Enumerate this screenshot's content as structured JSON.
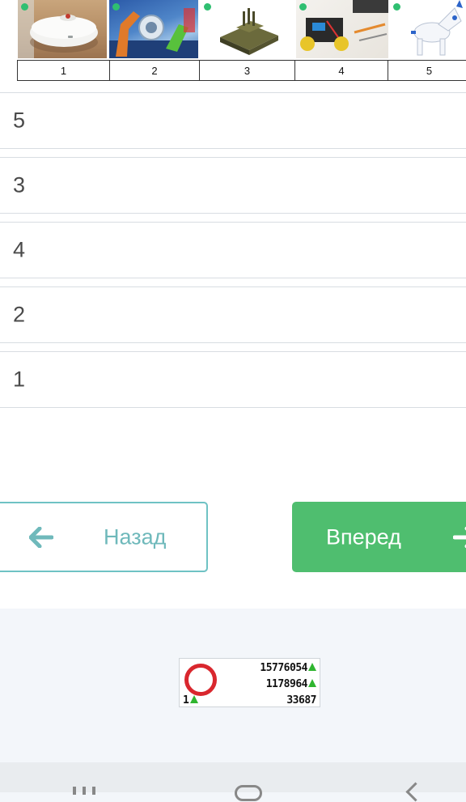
{
  "images": [
    {
      "number": "1",
      "icon": "robot-vacuum"
    },
    {
      "number": "2",
      "icon": "industrial-robot-arm"
    },
    {
      "number": "3",
      "icon": "robotic-tank"
    },
    {
      "number": "4",
      "icon": "diy-robot-kit"
    },
    {
      "number": "5",
      "icon": "robot-dog"
    }
  ],
  "answers": [
    "5",
    "3",
    "4",
    "2",
    "1"
  ],
  "buttons": {
    "back_label": "Назад",
    "next_label": "Вперед"
  },
  "counter": {
    "line1": "15776054",
    "line2": "1178964",
    "line3": "33687",
    "rank": "1"
  },
  "colors": {
    "accent_green": "#4fbe6f",
    "accent_teal": "#6fc2c4"
  }
}
